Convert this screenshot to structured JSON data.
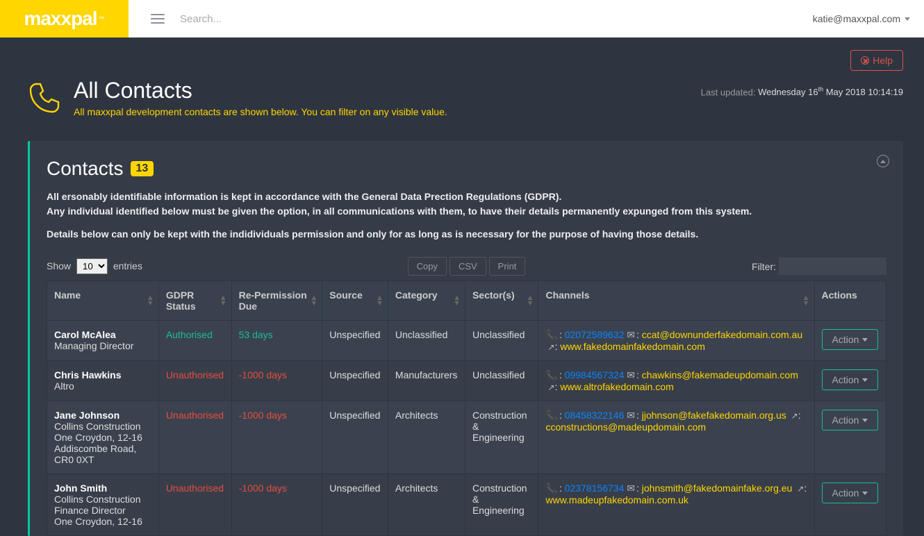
{
  "topbar": {
    "logo": "maxxpal",
    "logo_tm": "™",
    "search_placeholder": "Search...",
    "user": "katie@maxxpal.com"
  },
  "help_button": "Help",
  "page": {
    "title": "All Contacts",
    "subtitle": "All maxxpal development contacts are shown below.  You can filter on any visible value.",
    "last_updated_label": "Last updated: ",
    "last_updated_value_pre": "Wednesday 16",
    "last_updated_sup": "th",
    "last_updated_value_post": " May 2018 10:14:19"
  },
  "panel": {
    "title": "Contacts",
    "count": "13",
    "gdpr_line1": "All ersonably identifiable information is kept in accordance with the General Data Prection Regulations (GDPR).",
    "gdpr_line2": "Any individual identified below must be given the option, in all communications with them, to have their details permanently expunged from this system.",
    "gdpr_line3": "Details below can only be kept with the indidividuals permission and only for as long as is necessary for the purpose of having those details."
  },
  "controls": {
    "show_label": "Show",
    "entries_label": "entries",
    "page_size": "10",
    "copy": "Copy",
    "csv": "CSV",
    "print": "Print",
    "filter_label": "Filter:"
  },
  "columns": {
    "name": "Name",
    "gdpr": "GDPR Status",
    "due": "Re-Permission Due",
    "source": "Source",
    "category": "Category",
    "sector": "Sector(s)",
    "channels": "Channels",
    "actions": "Actions"
  },
  "action_label": "Action",
  "rows": [
    {
      "name": "Carol McAlea",
      "sub": "Managing Director",
      "gdpr": "Authorised",
      "gdpr_class": "auth",
      "due": "53 days",
      "due_class": "due-green",
      "source": "Unspecified",
      "category": "Unclassified",
      "sector": "Unclassified",
      "phone": "02072589632",
      "email": "ccat@downunderfakedomain.com.au",
      "web": "www.fakedomainfakedomain.com"
    },
    {
      "name": "Chris Hawkins",
      "sub": "Altro",
      "gdpr": "Unauthorised",
      "gdpr_class": "unauth",
      "due": "-1000 days",
      "due_class": "due-red",
      "source": "Unspecified",
      "category": "Manufacturers",
      "sector": "Unclassified",
      "phone": "09984567324",
      "email": "chawkins@fakemadeupdomain.com",
      "web": "www.altrofakedomain.com"
    },
    {
      "name": "Jane Johnson",
      "sub": "Collins Construction\nOne Croydon, 12-16 Addiscombe Road, CR0 0XT",
      "gdpr": "Unauthorised",
      "gdpr_class": "unauth",
      "due": "-1000 days",
      "due_class": "due-red",
      "source": "Unspecified",
      "category": "Architects",
      "sector": "Construction & Engineering",
      "phone": "08458322146",
      "email": "jjohnson@fakefakedomain.org.us",
      "web": "cconstructions@madeupdomain.com"
    },
    {
      "name": "John Smith",
      "sub": "Collins Construction\nFinance Director\nOne Croydon, 12-16",
      "gdpr": "Unauthorised",
      "gdpr_class": "unauth",
      "due": "-1000 days",
      "due_class": "due-red",
      "source": "Unspecified",
      "category": "Architects",
      "sector": "Construction & Engineering",
      "phone": "02378156734",
      "email": "johnsmith@fakedomainfake.org.eu",
      "web": "www.madeupfakedomain.com.uk"
    }
  ]
}
